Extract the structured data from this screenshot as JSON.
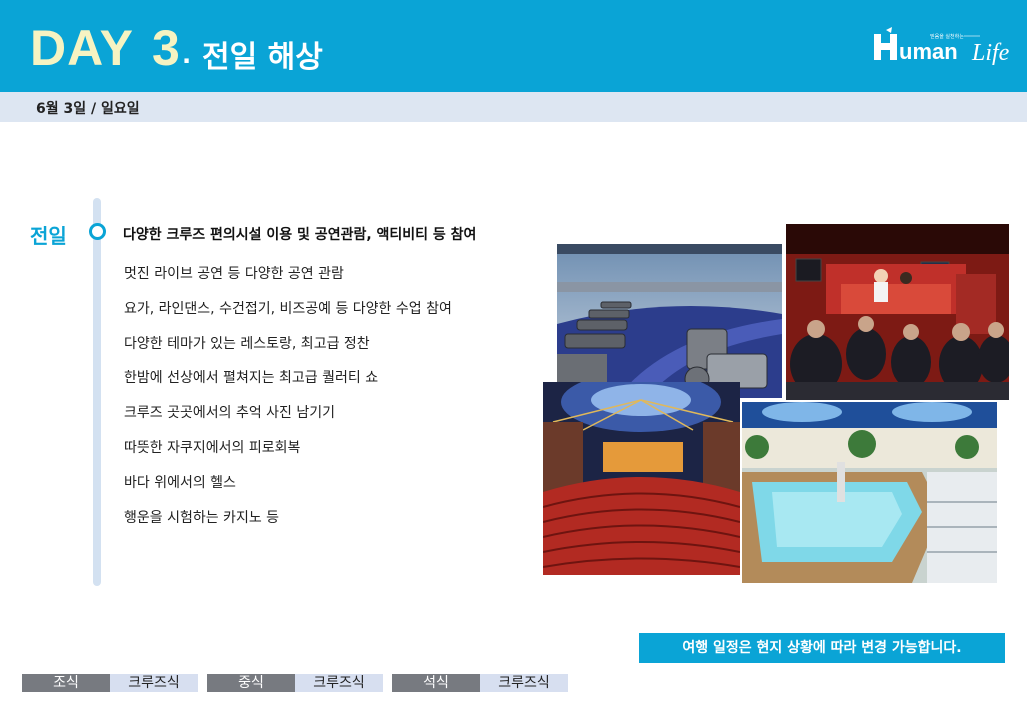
{
  "header": {
    "day_word": "DAY",
    "day_number": "3",
    "separator": ".",
    "title": "전일 해상",
    "logo": {
      "brand": "Human",
      "script": "Life",
      "tagline": "믿음을 실천하는"
    },
    "accent_color": "#0aa4d6"
  },
  "subheader": {
    "date": "6월 3일 / 일요일"
  },
  "schedule": {
    "label": "전일",
    "headline": "다양한 크루즈 편의시설 이용 및 공연관람, 액티비티 등 참여",
    "items": [
      "멋진 라이브 공연 등 다양한 공연 관람",
      "요가, 라인댄스, 수건접기, 비즈공예 등 다양한 수업 참여",
      "다양한 테마가 있는 레스토랑, 최고급 정찬",
      "한밤에 선상에서 펼쳐지는 최고급 퀄러티 쇼",
      "크루즈 곳곳에서의 추억 사진 남기기",
      "따뜻한 자쿠지에서의 피로회복",
      "바다 위에서의 헬스",
      "행운을 시험하는 카지노 등"
    ]
  },
  "photos": [
    "fitness-center-photo",
    "live-show-lounge-photo",
    "theater-photo",
    "jacuzzi-pool-photo"
  ],
  "notice": "여행 일정은 현지 상황에 따라 변경 가능합니다.",
  "meals": [
    {
      "label": "조식",
      "value": "크루즈식"
    },
    {
      "label": "중식",
      "value": "크루즈식"
    },
    {
      "label": "석식",
      "value": "크루즈식"
    }
  ]
}
